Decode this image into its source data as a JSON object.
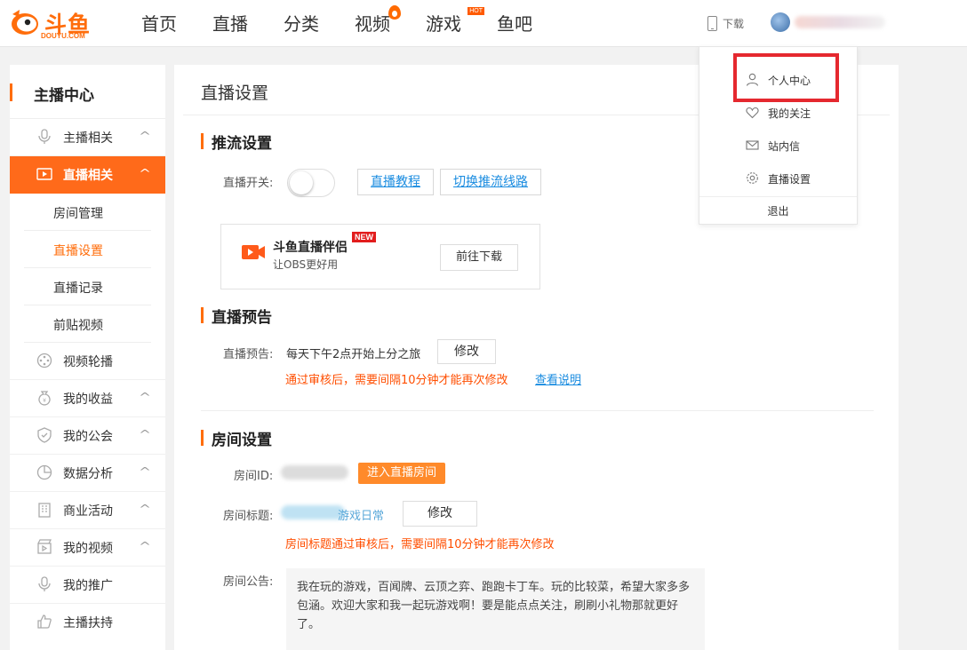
{
  "brand": {
    "logo_text": "斗鱼",
    "logo_sub": "DOUYU.COM",
    "accent": "#ff6d0b"
  },
  "nav": {
    "items": [
      {
        "label": "首页"
      },
      {
        "label": "直播"
      },
      {
        "label": "分类"
      },
      {
        "label": "视频",
        "badge": "fire-icon"
      },
      {
        "label": "游戏",
        "badge_text": "HOT"
      },
      {
        "label": "鱼吧"
      }
    ],
    "download_label": "下载"
  },
  "sidebar": {
    "title": "主播中心",
    "items": [
      {
        "label": "主播相关",
        "icon": "microphone-icon"
      },
      {
        "label": "直播相关",
        "icon": "video-play-icon",
        "active": true
      },
      {
        "label": "房间管理"
      },
      {
        "label": "直播设置",
        "selected": true
      },
      {
        "label": "直播记录"
      },
      {
        "label": "前贴视频"
      },
      {
        "label": "视频轮播",
        "icon": "film-reel-icon"
      },
      {
        "label": "我的收益",
        "icon": "money-bag-icon"
      },
      {
        "label": "我的公会",
        "icon": "shield-icon"
      },
      {
        "label": "数据分析",
        "icon": "pie-chart-icon"
      },
      {
        "label": "商业活动",
        "icon": "building-icon"
      },
      {
        "label": "我的视频",
        "icon": "clapperboard-icon"
      },
      {
        "label": "我的推广",
        "icon": "microphone-icon"
      },
      {
        "label": "主播扶持",
        "icon": "thumbs-up-icon"
      }
    ]
  },
  "main": {
    "title": "直播设置",
    "stream": {
      "section_title": "推流设置",
      "switch_label": "直播开关:",
      "switch_on": false,
      "tutorial_link": "直播教程",
      "switch_line_link": "切换推流线路",
      "promo": {
        "title": "斗鱼直播伴侣",
        "new_badge": "NEW",
        "subtitle": "让OBS更好用",
        "button": "前往下载"
      }
    },
    "preview": {
      "section_title": "直播预告",
      "label": "直播预告:",
      "value": "每天下午2点开始上分之旅",
      "edit_button": "修改",
      "warning": "通过审核后，需要间隔10分钟才能再次修改",
      "help_link": "查看说明"
    },
    "room": {
      "section_title": "房间设置",
      "id_label": "房间ID:",
      "enter_button": "进入直播房间",
      "title_label": "房间标题:",
      "title_visible_fragment": "游戏日常",
      "edit_button": "修改",
      "title_warning": "房间标题通过审核后，需要间隔10分钟才能再次修改",
      "notice_label": "房间公告:",
      "notice_text": "我在玩的游戏，百闻牌、云顶之弈、跑跑卡丁车。玩的比较菜，希望大家多多包涵。欢迎大家和我一起玩游戏啊！要是能点点关注，刷刷小礼物那就更好了。"
    }
  },
  "user_menu": {
    "items": [
      {
        "label": "个人中心",
        "icon": "user-icon",
        "highlighted": true
      },
      {
        "label": "我的关注",
        "icon": "heart-icon"
      },
      {
        "label": "站内信",
        "icon": "mail-icon"
      },
      {
        "label": "直播设置",
        "icon": "gear-icon"
      }
    ],
    "logout": "退出",
    "highlight_color": "#e5282f"
  }
}
